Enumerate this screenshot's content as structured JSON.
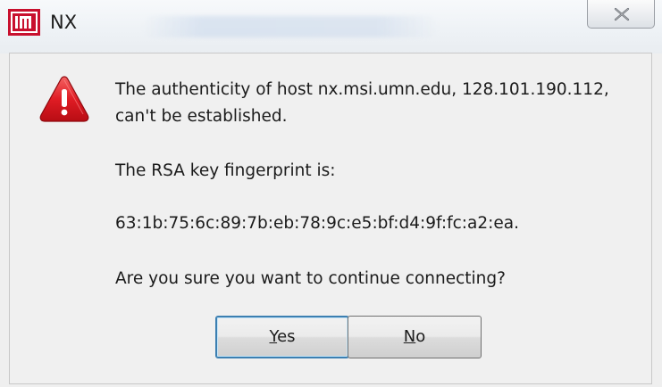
{
  "window": {
    "title": "NX",
    "title_blurred_text": "",
    "close_label": ""
  },
  "message": {
    "line1": "The authenticity of host nx.msi.umn.edu, 128.101.190.112,",
    "line2": "can't be established.",
    "fingerprint_label": "The RSA key fingerprint is:",
    "fingerprint": "63:1b:75:6c:89:7b:eb:78:9c:e5:bf:d4:9f:fc:a2:ea.",
    "question": "Are you sure you want to continue connecting?"
  },
  "buttons": {
    "yes_mnemonic": "Y",
    "yes_rest": "es",
    "no_mnemonic": "N",
    "no_rest": "o"
  },
  "icons": {
    "app": "nx-app-icon",
    "warning": "warning-triangle-icon",
    "close": "close-icon"
  },
  "colors": {
    "app_icon_red": "#c8102e",
    "warning_red": "#d8141c",
    "default_button_border": "#3c7fb1"
  }
}
